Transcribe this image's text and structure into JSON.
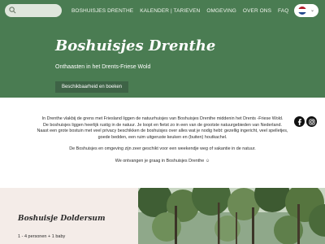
{
  "header": {
    "nav": [
      "Boshuisjes Drenthe",
      "Kalender | Tarieven",
      "Omgeving",
      "Over ons",
      "FAQ"
    ],
    "language_flag_colors": [
      "#ae1c28",
      "#ffffff",
      "#21468b"
    ],
    "language_chevron": "⌄"
  },
  "hero": {
    "title": "Boshuisjes Drenthe",
    "subtitle": "Onthaasten in het Drents-Friese Wold",
    "button_label": "Beschikbaarheid en boeken"
  },
  "intro": {
    "lines": [
      "In Drenthe vlakbij de grens met Friesland liggen de natuurhuisjes van Boshuisjes Drenthe middenin het Drents -Friese Wold.",
      "De boshuisjes liggen heerlijk rustig in de natuur. Je loopt en fietst zo in een van de grootste natuurgebieden van Nederland.",
      "Naast een grote bostuin met veel privacy beschikken de boshuisjes over alles wat je nodig hebt: gezellig ingericht, veel spelletjes,",
      "goede bedden, een ruim uitgeruste keuken en (buiten) houtkachel.",
      "De Boshuisjes en omgeving zijn zeer geschikt voor een weekendje weg of vakantie in de natuur.",
      "We ontvangen je graag in Boshuisjes Drenthe ☺"
    ]
  },
  "social": {
    "icons": [
      "facebook-icon",
      "instagram-icon"
    ]
  },
  "listing": {
    "title": "Boshuisje Doldersum",
    "line": "1 - 4 personen + 1 baby"
  },
  "colors": {
    "brand_green": "#4a7c52",
    "button_green": "#3e6346",
    "card_bg": "#f4ece8"
  }
}
